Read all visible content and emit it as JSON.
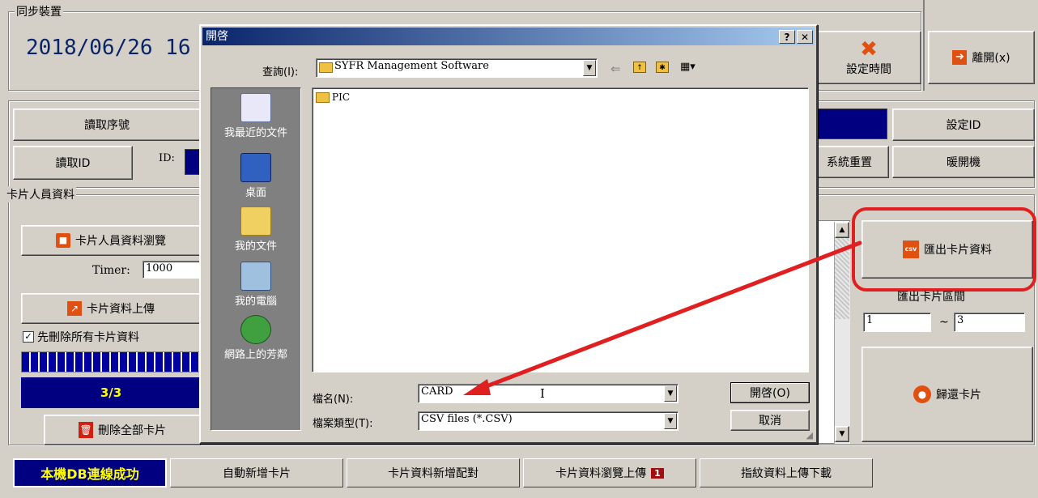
{
  "app": {
    "sync_group_title": "同步裝置",
    "datetime": "2018/06/26 16",
    "set_time_label": "設定時間",
    "exit_label": "離開(x)",
    "read_serial_label": "讀取序號",
    "set_id_label": "設定ID",
    "read_id_label": "讀取ID",
    "id_label": "ID:",
    "system_reset_label": "系統重置",
    "warm_boot_label": "暖開機",
    "card_group_title": "卡片人員資料",
    "card_browse_label": "卡片人員資料瀏覽",
    "timer_label": "Timer:",
    "timer_value": "1000",
    "card_upload_label": "卡片資料上傳",
    "delete_all_first_label": "先刪除所有卡片資料",
    "delete_all_first_checked": true,
    "progress_text": "3/3",
    "progress_value": 1.0,
    "delete_all_cards_label": "刪除全部卡片",
    "export_card_label": "匯出卡片資料",
    "export_range_label": "匯出卡片區間",
    "range_from": "1",
    "range_sep": "~",
    "range_to": "3",
    "return_card_label": "歸還卡片"
  },
  "bottom_tabs": {
    "status": "本機DB連線成功",
    "tabs": [
      "自動新增卡片",
      "卡片資料新增配對",
      "卡片資料瀏覽上傳",
      "指紋資料上傳下載"
    ],
    "badge": "1"
  },
  "dialog": {
    "title": "開啓",
    "help_glyph": "?",
    "close_glyph": "✕",
    "lookin_label": "查詢(I):",
    "lookin_value": "SYFR Management Software",
    "places": [
      "我最近的文件",
      "桌面",
      "我的文件",
      "我的電腦",
      "網路上的芳鄰"
    ],
    "files": [
      "PIC"
    ],
    "filename_label": "檔名(N):",
    "filename_value": "CARD",
    "filetype_label": "檔案類型(T):",
    "filetype_value": "CSV files (*.CSV)",
    "open_label": "開啓(O)",
    "cancel_label": "取消"
  },
  "icons": {
    "folder": "folder-icon",
    "back": "back-arrow-icon",
    "up": "up-folder-icon",
    "new_folder": "new-folder-icon",
    "view": "view-menu-icon",
    "csv": "csv-file-icon",
    "user": "user-icon",
    "upload": "upload-icon",
    "trash": "trash-icon",
    "tools": "tools-icon",
    "exit": "exit-icon",
    "return": "return-card-icon"
  },
  "colors": {
    "dialog_title": "#0a246a",
    "highlight": "#e02020",
    "status_bg": "#000080",
    "status_text": "#ffff00"
  }
}
